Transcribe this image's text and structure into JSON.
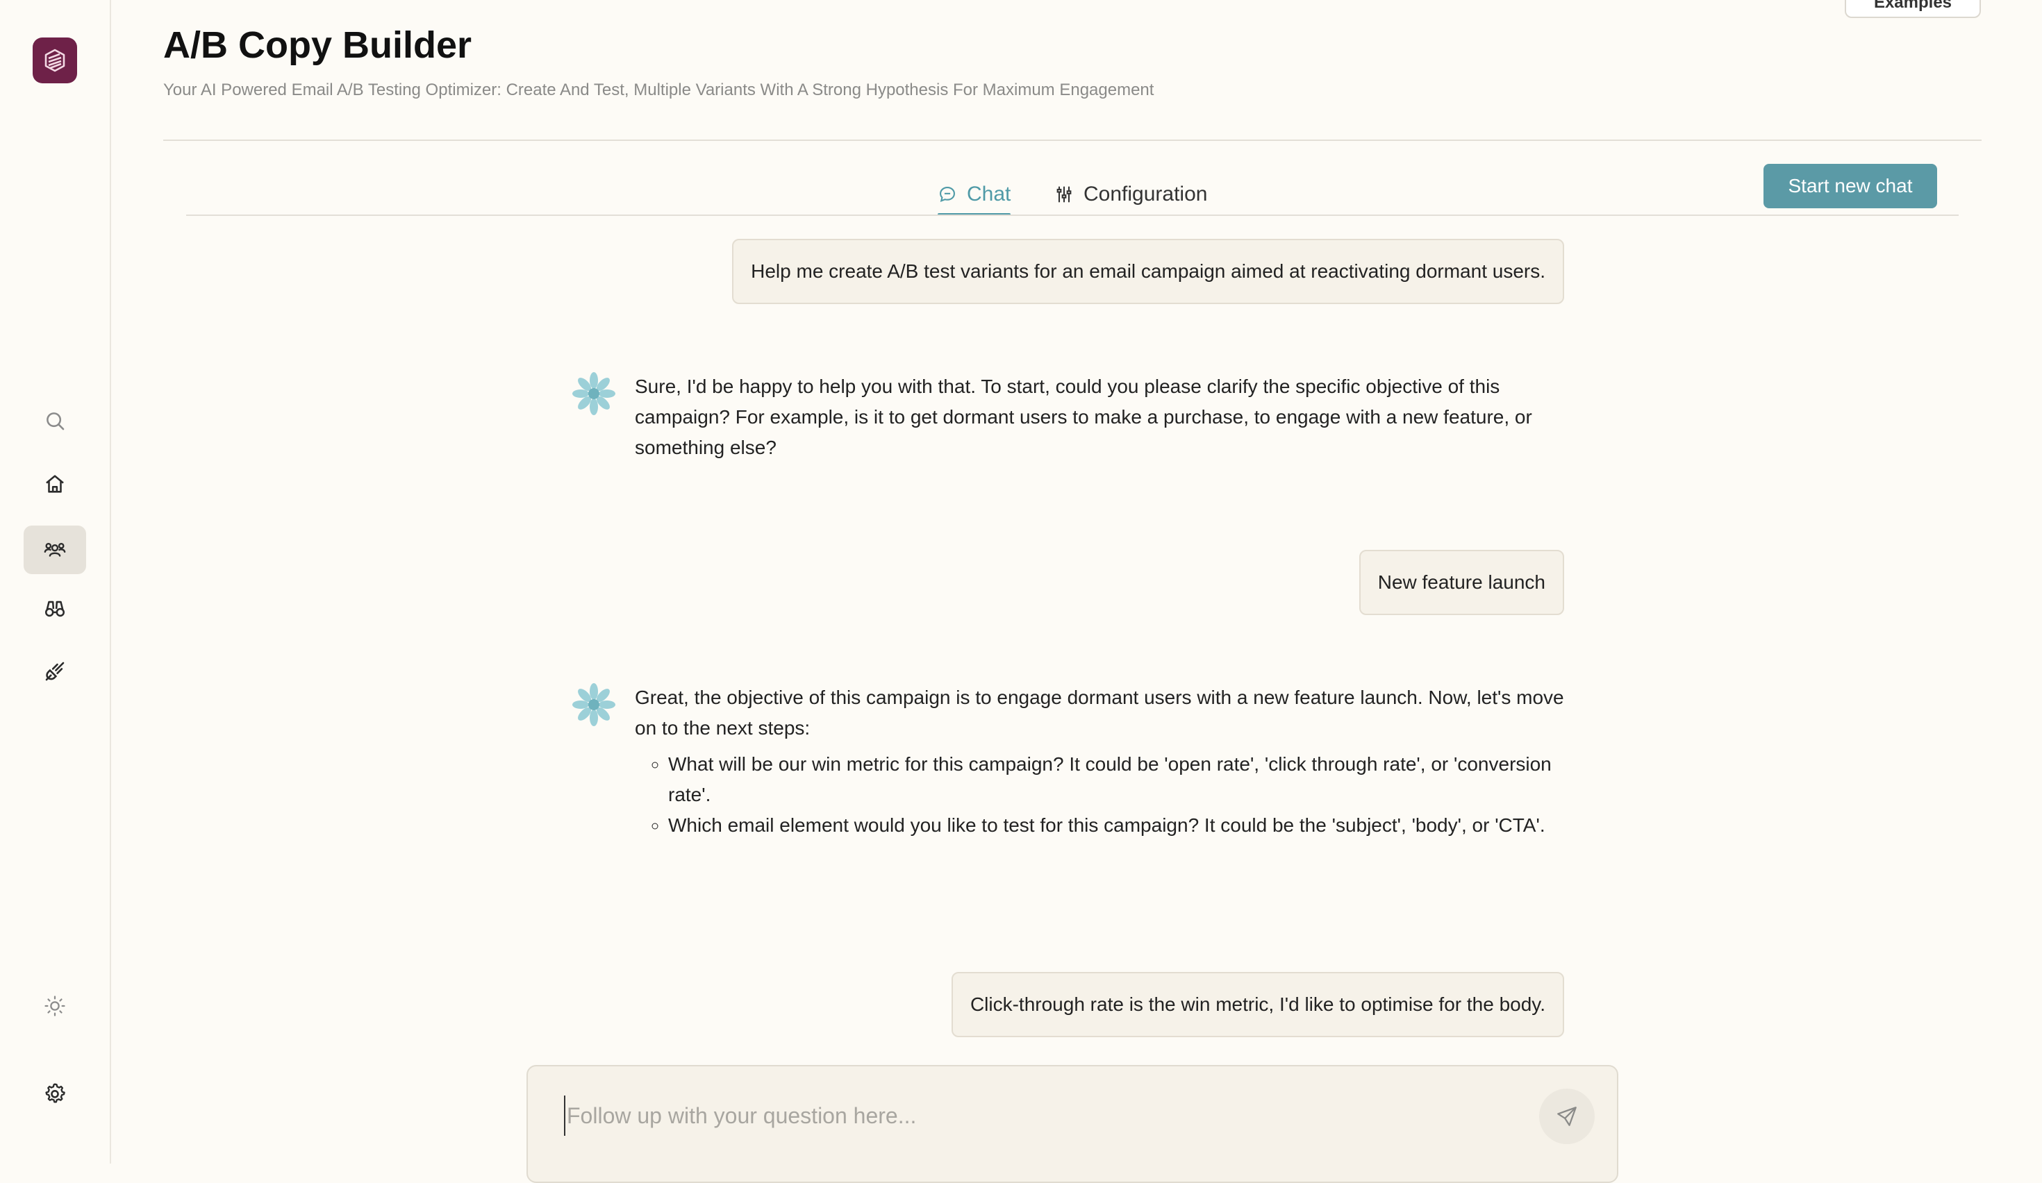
{
  "app": {
    "title": "A/B Copy Builder",
    "subtitle": "Your AI Powered Email A/B Testing Optimizer: Create And Test, Multiple Variants With A Strong Hypothesis For Maximum Engagement",
    "examples_label": "Examples"
  },
  "sidebar": {
    "items": [
      {
        "name": "search-icon"
      },
      {
        "name": "home-icon"
      },
      {
        "name": "users-icon",
        "active": true
      },
      {
        "name": "binoculars-icon"
      },
      {
        "name": "plug-icon"
      },
      {
        "name": "sun-icon"
      },
      {
        "name": "gear-icon"
      }
    ]
  },
  "tabs": [
    {
      "label": "Chat",
      "icon": "chat-bubble-icon",
      "active": true
    },
    {
      "label": "Configuration",
      "icon": "sliders-icon",
      "active": false
    }
  ],
  "new_chat_label": "Start new chat",
  "messages": [
    {
      "role": "user",
      "text": "Help me create A/B test variants for an email campaign aimed at reactivating dormant users."
    },
    {
      "role": "assistant",
      "paragraphs": [
        "Sure, I'd be happy to help you with that. To start, could you please clarify the specific objective of this campaign? For example, is it to get dormant users to make a purchase, to engage with a new feature, or something else?"
      ]
    },
    {
      "role": "user",
      "text": "New feature launch"
    },
    {
      "role": "assistant",
      "paragraphs": [
        "Great, the objective of this campaign is to engage dormant users with a new feature launch. Now, let's move on to the next steps:"
      ],
      "bullets": [
        "What will be our win metric for this campaign? It could be 'open rate', 'click through rate', or 'conversion rate'.",
        "Which email element would you like to test for this campaign? It could be the 'subject', 'body', or 'CTA'."
      ]
    },
    {
      "role": "user",
      "text": "Click-through rate is the win metric, I'd like to optimise for the body."
    }
  ],
  "input": {
    "placeholder": "Follow up with your question here...",
    "value": ""
  },
  "colors": {
    "accent": "#5b9aa6",
    "logo": "#6e2148",
    "background": "#fdfbf6"
  }
}
